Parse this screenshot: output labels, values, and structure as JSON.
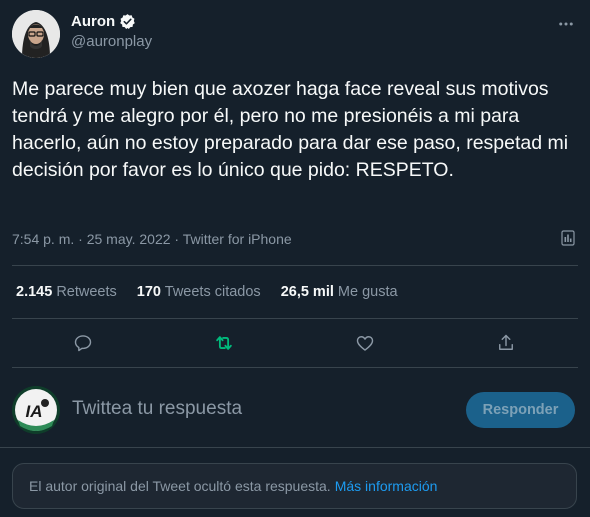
{
  "author": {
    "display_name": "Auron",
    "handle": "@auronplay",
    "verified": true,
    "avatar_icon": "user-avatar"
  },
  "tweet": {
    "text": "Me parece muy bien que axozer haga face reveal sus motivos tendrá y me alegro por él, pero no me presionéis a mi para hacerlo, aún no estoy preparado para dar ese paso, respetad mi decisión por favor es lo único que pido: RESPETO.",
    "time": "7:54 p. m.",
    "separator": "·",
    "date": "25 may. 2022",
    "source": "Twitter for iPhone"
  },
  "stats": {
    "retweets_count": "2.145",
    "retweets_label": "Retweets",
    "quotes_count": "170",
    "quotes_label": "Tweets citados",
    "likes_count": "26,5 mil",
    "likes_label": "Me gusta"
  },
  "actions": {
    "icons": [
      "reply-icon",
      "retweet-icon",
      "like-icon",
      "share-icon"
    ],
    "retweet_active_color": "#00ba7c"
  },
  "reply": {
    "placeholder": "Twittea tu respuesta",
    "button_label": "Responder",
    "avatar_text": "IA"
  },
  "hidden_notice": {
    "text": "El autor original del Tweet ocultó esta respuesta.",
    "link_text": "Más información"
  },
  "colors": {
    "background": "#15202b",
    "accent": "#1d9bf0",
    "muted": "#8b98a5",
    "border": "#38444d"
  }
}
